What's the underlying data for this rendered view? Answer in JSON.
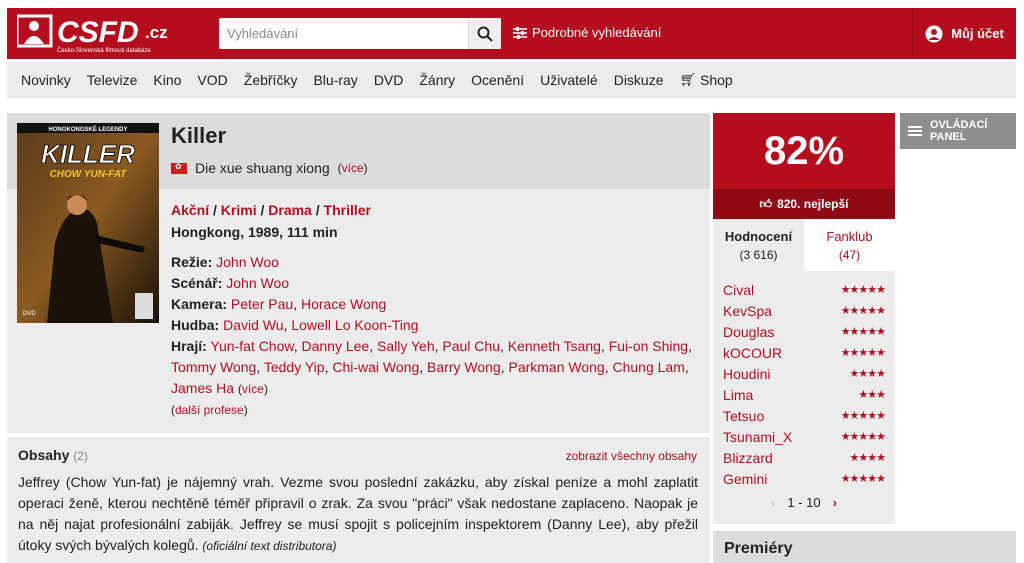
{
  "header": {
    "logo_text": "CSFD.cz",
    "logo_sub": "Česko-Slovenská filmová databáze",
    "search_placeholder": "Vyhledávání",
    "advanced_search": "Podrobné vyhledávání",
    "account": "Můj účet"
  },
  "nav": {
    "items": [
      "Novinky",
      "Televize",
      "Kino",
      "VOD",
      "Žebříčky",
      "Blu-ray",
      "DVD",
      "Žánry",
      "Ocenění",
      "Uživatelé",
      "Diskuze"
    ],
    "shop": "Shop"
  },
  "film": {
    "title": "Killer",
    "original_title": "Die xue shuang xiong",
    "more_label": "více",
    "poster_top": "HONGKONGSKÉ LEGENDY",
    "poster_title": "KILLER",
    "poster_sub": "CHOW YUN-FAT",
    "genres": [
      "Akční",
      "Krimi",
      "Drama",
      "Thriller"
    ],
    "origin": "Hongkong, 1989, 111 min",
    "directing_label": "Režie:",
    "directing": [
      "John Woo"
    ],
    "writing_label": "Scénář:",
    "writing": [
      "John Woo"
    ],
    "camera_label": "Kamera:",
    "camera": [
      "Peter Pau",
      "Horace Wong"
    ],
    "music_label": "Hudba:",
    "music": [
      "David Wu",
      "Lowell Lo Koon-Ting"
    ],
    "cast_label": "Hrají:",
    "cast": [
      "Yun-fat Chow",
      "Danny Lee",
      "Sally Yeh",
      "Paul Chu",
      "Kenneth Tsang",
      "Fui-on Shing",
      "Tommy Wong",
      "Teddy Yip",
      "Chi-wai Wong",
      "Barry Wong",
      "Parkman Wong",
      "Chung Lam",
      "James Ha"
    ],
    "more_professions": "další profese"
  },
  "plot": {
    "title": "Obsahy",
    "count": "(2)",
    "show_all": "zobrazit všechny obsahy",
    "text": "Jeffrey (Chow Yun-fat) je nájemný vrah. Vezme svou poslední zakázku, aby získal peníze a mohl zaplatit operaci ženě, kterou nechtěně téměř připravil o zrak. Za svou \"práci\" však nedostane zaplaceno. Naopak je na něj najat profesionální zabiják. Jeffrey se musí spojit s policejním inspektorem (Danny Lee), aby přežil útoky svých bývalých kolegů.",
    "source": "(oficiální text distributora)"
  },
  "rating": {
    "percent": "82%",
    "rank": "820. nejlepší",
    "tab_ratings": "Hodnocení",
    "tab_ratings_count": "(3 616)",
    "tab_fanclub": "Fanklub",
    "tab_fanclub_count": "(47)",
    "list": [
      {
        "user": "Cival",
        "stars": 5
      },
      {
        "user": "KevSpa",
        "stars": 5
      },
      {
        "user": "Douglas",
        "stars": 5
      },
      {
        "user": "kOCOUR",
        "stars": 5
      },
      {
        "user": "Houdini",
        "stars": 4
      },
      {
        "user": "Lima",
        "stars": 3
      },
      {
        "user": "Tetsuo",
        "stars": 5
      },
      {
        "user": "Tsunami_X",
        "stars": 5
      },
      {
        "user": "Blizzard",
        "stars": 4
      },
      {
        "user": "Gemini",
        "stars": 5
      }
    ],
    "pager": "1 - 10"
  },
  "control_panel": {
    "line1": "OVLÁDACÍ",
    "line2": "PANEL"
  },
  "premiery": "Premiéry"
}
